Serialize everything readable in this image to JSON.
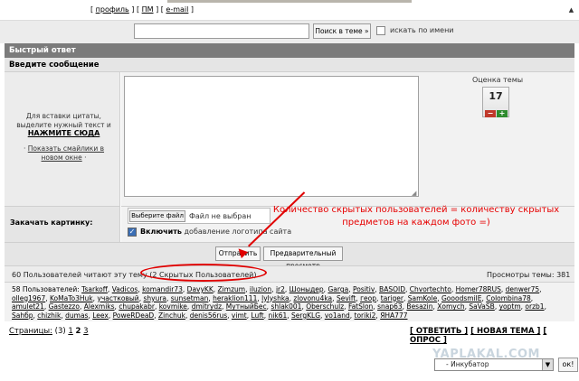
{
  "top_links": {
    "profile": "профиль",
    "pm": "ПМ",
    "email": "e-mail"
  },
  "search": {
    "button": "Поиск в теме »",
    "names_label": "искать по имени"
  },
  "quick_reply": {
    "title": "Быстрый ответ",
    "message_label": "Введите сообщение",
    "quote_hint": "Для вставки цитаты, выделите нужный текст и",
    "click_here": "НАЖМИТЕ СЮДА",
    "show_smiles": "Показать смайлики в новом окне"
  },
  "rating": {
    "label": "Оценка темы",
    "value": "17",
    "minus": "−",
    "plus": "+"
  },
  "upload": {
    "label": "Закачать картинку:",
    "choose_button": "Выберите файл",
    "file_status": "Файл не выбран",
    "logo_bold": "Включить",
    "logo_rest": " добавление логотипа сайта"
  },
  "annotation": "Количество скрытых пользователей = количеству скрытых предметов на каждом фото =)",
  "buttons": {
    "send": "Отправить",
    "preview": "Предварительный просмотр"
  },
  "readers": {
    "text": "60 Пользователей читают эту тему (2 Скрытых Пользователей)",
    "views": "Просмотры темы: 381"
  },
  "users": {
    "prefix": "58 Пользователей:",
    "names": [
      "Tsarkoff",
      "Vadicos",
      "komandir73",
      "DavyKK",
      "Zimzum",
      "iluzion",
      "jr2",
      "Шоныдер",
      "Garga",
      "Positiv",
      "BASOID",
      "Chvortechto",
      "Homer78RUS",
      "denwer75",
      "olleg1967",
      "KoMaTo3Huk",
      "участковый",
      "shyura",
      "sunsetman",
      "heraklion111",
      "lylyshka",
      "zlovonu4ka",
      "Sevift",
      "геор",
      "tariger",
      "SamKole",
      "GooodsmilE",
      "Colombina78",
      "amulet21",
      "Gastezzo",
      "Alexmiks",
      "chupakabr",
      "kovmike",
      "dmitrydz",
      "МутныйБес",
      "shlak001",
      "Oberschulz",
      "FatSlon",
      "snap63",
      "Besazin",
      "Xomych",
      "SaVaSB",
      "yoptm",
      "orzb1",
      "Sahбр",
      "chizhik",
      "dumas",
      "Leex",
      "PoweRDeaD",
      "Zinchuk",
      "denis56rus",
      "vimt",
      "Luft",
      "nik61",
      "SergKLG",
      "vo1and",
      "toriki2",
      "ЯНА777"
    ]
  },
  "pagination": {
    "label": "Страницы:",
    "count": "(3)",
    "pages": [
      "1",
      "2",
      "3"
    ],
    "current": "2"
  },
  "reply_links": {
    "reply": "[ ОТВЕТИТЬ ]",
    "new_topic": "[ НОВАЯ ТЕМА ]",
    "poll": "[ ОПРОС ]"
  },
  "watermark": "YAPLAKAL.COM",
  "jump": {
    "selected": "- Инкубатор",
    "ok": "ок!"
  }
}
